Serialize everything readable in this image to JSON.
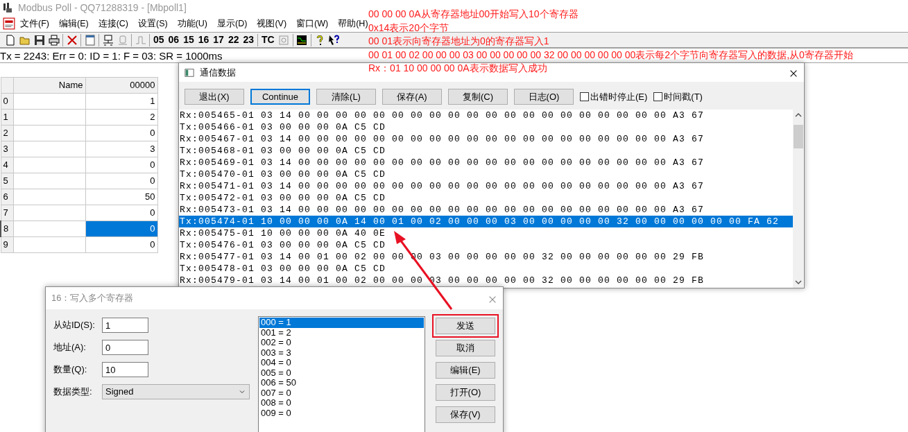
{
  "app": {
    "title": "Modbus Poll - QQ71288319 - [Mbpoll1]",
    "menu": [
      "文件(F)",
      "编辑(E)",
      "连接(C)",
      "设置(S)",
      "功能(U)",
      "显示(D)",
      "视图(V)",
      "窗口(W)",
      "帮助(H)"
    ],
    "function_codes": [
      "05",
      "06",
      "15",
      "16",
      "17",
      "22",
      "23"
    ],
    "tc_button": "TC",
    "status": "Tx = 2243: Err = 0: ID = 1: F = 03: SR = 1000ms"
  },
  "table": {
    "columns": [
      "Name",
      "00000"
    ],
    "rows": [
      {
        "index": "0",
        "value": "1",
        "selected": false
      },
      {
        "index": "1",
        "value": "2",
        "selected": false
      },
      {
        "index": "2",
        "value": "0",
        "selected": false
      },
      {
        "index": "3",
        "value": "3",
        "selected": false
      },
      {
        "index": "4",
        "value": "0",
        "selected": false
      },
      {
        "index": "5",
        "value": "0",
        "selected": false
      },
      {
        "index": "6",
        "value": "50",
        "selected": false
      },
      {
        "index": "7",
        "value": "0",
        "selected": false
      },
      {
        "index": "8",
        "value": "0",
        "selected": true
      },
      {
        "index": "9",
        "value": "0",
        "selected": false
      }
    ]
  },
  "comm_window": {
    "title": "通信数据",
    "buttons": [
      {
        "label": "退出(X)",
        "default": false
      },
      {
        "label": "Continue",
        "default": true
      },
      {
        "label": "清除(L)",
        "default": false
      },
      {
        "label": "保存(A)",
        "default": false
      },
      {
        "label": "复制(C)",
        "default": false
      },
      {
        "label": "日志(O)",
        "default": false
      }
    ],
    "checkboxes": [
      {
        "label": "出错时停止(E)",
        "checked": false
      },
      {
        "label": "时间戳(T)",
        "checked": false
      }
    ],
    "log": [
      {
        "text": "Rx:005465-01 03 14 00 00 00 00 00 00 00 00 00 00 00 00 00 00 00 00 00 00 00 00 A3 67",
        "selected": false
      },
      {
        "text": "Tx:005466-01 03 00 00 00 0A C5 CD",
        "selected": false
      },
      {
        "text": "Rx:005467-01 03 14 00 00 00 00 00 00 00 00 00 00 00 00 00 00 00 00 00 00 00 00 A3 67",
        "selected": false
      },
      {
        "text": "Tx:005468-01 03 00 00 00 0A C5 CD",
        "selected": false
      },
      {
        "text": "Rx:005469-01 03 14 00 00 00 00 00 00 00 00 00 00 00 00 00 00 00 00 00 00 00 00 A3 67",
        "selected": false
      },
      {
        "text": "Tx:005470-01 03 00 00 00 0A C5 CD",
        "selected": false
      },
      {
        "text": "Rx:005471-01 03 14 00 00 00 00 00 00 00 00 00 00 00 00 00 00 00 00 00 00 00 00 A3 67",
        "selected": false
      },
      {
        "text": "Tx:005472-01 03 00 00 00 0A C5 CD",
        "selected": false
      },
      {
        "text": "Rx:005473-01 03 14 00 00 00 00 00 00 00 00 00 00 00 00 00 00 00 00 00 00 00 00 A3 67",
        "selected": false
      },
      {
        "text": "Tx:005474-01 10 00 00 00 0A 14 00 01 00 02 00 00 00 03 00 00 00 00 00 32 00 00 00 00 00 00 FA 62",
        "selected": true
      },
      {
        "text": "Rx:005475-01 10 00 00 00 0A 40 0E",
        "selected": false
      },
      {
        "text": "Tx:005476-01 03 00 00 00 0A C5 CD",
        "selected": false
      },
      {
        "text": "Rx:005477-01 03 14 00 01 00 02 00 00 00 03 00 00 00 00 00 32 00 00 00 00 00 00 29 FB",
        "selected": false
      },
      {
        "text": "Tx:005478-01 03 00 00 00 0A C5 CD",
        "selected": false
      },
      {
        "text": "Rx:005479-01 03 14 00 01 00 02 00 00 00 03 00 00 00 00 00 32 00 00 00 00 00 00 29 FB",
        "selected": false
      }
    ]
  },
  "write_dialog": {
    "title": "16：写入多个寄存器",
    "fields": [
      {
        "label": "从站ID(S):",
        "value": "1"
      },
      {
        "label": "地址(A):",
        "value": "0"
      },
      {
        "label": "数量(Q):",
        "value": "10"
      }
    ],
    "data_type": {
      "label": "数据类型:",
      "value": "Signed"
    },
    "values": [
      {
        "text": "000 = 1",
        "selected": true
      },
      {
        "text": "001 = 2",
        "selected": false
      },
      {
        "text": "002 = 0",
        "selected": false
      },
      {
        "text": "003 = 3",
        "selected": false
      },
      {
        "text": "004 = 0",
        "selected": false
      },
      {
        "text": "005 = 0",
        "selected": false
      },
      {
        "text": "006 = 50",
        "selected": false
      },
      {
        "text": "007 = 0",
        "selected": false
      },
      {
        "text": "008 = 0",
        "selected": false
      },
      {
        "text": "009 = 0",
        "selected": false
      }
    ],
    "buttons": [
      {
        "label": "发送",
        "highlighted": true
      },
      {
        "label": "取消",
        "highlighted": false
      },
      {
        "label": "编辑(E)",
        "highlighted": false
      },
      {
        "label": "打开(O)",
        "highlighted": false
      },
      {
        "label": "保存(V)",
        "highlighted": false
      }
    ]
  },
  "annotations": [
    "00 00 00 0A从寄存器地址00开始写入10个寄存器",
    "0x14表示20个字节",
    "00 01表示向寄存器地址为0的寄存器写入1",
    "00 01 00 02 00 00 00 03 00 00 00 00 00 32 00 00 00 00 00 00表示每2个字节向寄存器写入的数据,从0寄存器开始",
    "Rx：01 10 00 00 00 0A表示数据写入成功"
  ]
}
